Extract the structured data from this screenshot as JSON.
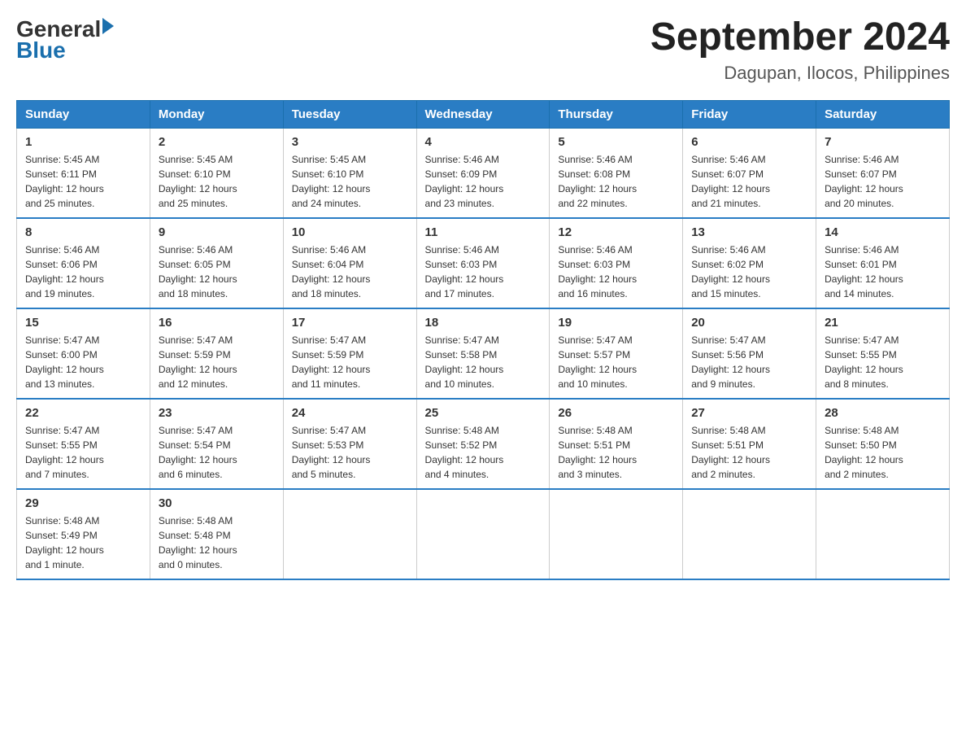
{
  "logo": {
    "general": "General",
    "triangle": "",
    "blue": "Blue"
  },
  "title": "September 2024",
  "subtitle": "Dagupan, Ilocos, Philippines",
  "days_of_week": [
    "Sunday",
    "Monday",
    "Tuesday",
    "Wednesday",
    "Thursday",
    "Friday",
    "Saturday"
  ],
  "weeks": [
    [
      {
        "day": "1",
        "sunrise": "5:45 AM",
        "sunset": "6:11 PM",
        "daylight": "12 hours and 25 minutes."
      },
      {
        "day": "2",
        "sunrise": "5:45 AM",
        "sunset": "6:10 PM",
        "daylight": "12 hours and 25 minutes."
      },
      {
        "day": "3",
        "sunrise": "5:45 AM",
        "sunset": "6:10 PM",
        "daylight": "12 hours and 24 minutes."
      },
      {
        "day": "4",
        "sunrise": "5:46 AM",
        "sunset": "6:09 PM",
        "daylight": "12 hours and 23 minutes."
      },
      {
        "day": "5",
        "sunrise": "5:46 AM",
        "sunset": "6:08 PM",
        "daylight": "12 hours and 22 minutes."
      },
      {
        "day": "6",
        "sunrise": "5:46 AM",
        "sunset": "6:07 PM",
        "daylight": "12 hours and 21 minutes."
      },
      {
        "day": "7",
        "sunrise": "5:46 AM",
        "sunset": "6:07 PM",
        "daylight": "12 hours and 20 minutes."
      }
    ],
    [
      {
        "day": "8",
        "sunrise": "5:46 AM",
        "sunset": "6:06 PM",
        "daylight": "12 hours and 19 minutes."
      },
      {
        "day": "9",
        "sunrise": "5:46 AM",
        "sunset": "6:05 PM",
        "daylight": "12 hours and 18 minutes."
      },
      {
        "day": "10",
        "sunrise": "5:46 AM",
        "sunset": "6:04 PM",
        "daylight": "12 hours and 18 minutes."
      },
      {
        "day": "11",
        "sunrise": "5:46 AM",
        "sunset": "6:03 PM",
        "daylight": "12 hours and 17 minutes."
      },
      {
        "day": "12",
        "sunrise": "5:46 AM",
        "sunset": "6:03 PM",
        "daylight": "12 hours and 16 minutes."
      },
      {
        "day": "13",
        "sunrise": "5:46 AM",
        "sunset": "6:02 PM",
        "daylight": "12 hours and 15 minutes."
      },
      {
        "day": "14",
        "sunrise": "5:46 AM",
        "sunset": "6:01 PM",
        "daylight": "12 hours and 14 minutes."
      }
    ],
    [
      {
        "day": "15",
        "sunrise": "5:47 AM",
        "sunset": "6:00 PM",
        "daylight": "12 hours and 13 minutes."
      },
      {
        "day": "16",
        "sunrise": "5:47 AM",
        "sunset": "5:59 PM",
        "daylight": "12 hours and 12 minutes."
      },
      {
        "day": "17",
        "sunrise": "5:47 AM",
        "sunset": "5:59 PM",
        "daylight": "12 hours and 11 minutes."
      },
      {
        "day": "18",
        "sunrise": "5:47 AM",
        "sunset": "5:58 PM",
        "daylight": "12 hours and 10 minutes."
      },
      {
        "day": "19",
        "sunrise": "5:47 AM",
        "sunset": "5:57 PM",
        "daylight": "12 hours and 10 minutes."
      },
      {
        "day": "20",
        "sunrise": "5:47 AM",
        "sunset": "5:56 PM",
        "daylight": "12 hours and 9 minutes."
      },
      {
        "day": "21",
        "sunrise": "5:47 AM",
        "sunset": "5:55 PM",
        "daylight": "12 hours and 8 minutes."
      }
    ],
    [
      {
        "day": "22",
        "sunrise": "5:47 AM",
        "sunset": "5:55 PM",
        "daylight": "12 hours and 7 minutes."
      },
      {
        "day": "23",
        "sunrise": "5:47 AM",
        "sunset": "5:54 PM",
        "daylight": "12 hours and 6 minutes."
      },
      {
        "day": "24",
        "sunrise": "5:47 AM",
        "sunset": "5:53 PM",
        "daylight": "12 hours and 5 minutes."
      },
      {
        "day": "25",
        "sunrise": "5:48 AM",
        "sunset": "5:52 PM",
        "daylight": "12 hours and 4 minutes."
      },
      {
        "day": "26",
        "sunrise": "5:48 AM",
        "sunset": "5:51 PM",
        "daylight": "12 hours and 3 minutes."
      },
      {
        "day": "27",
        "sunrise": "5:48 AM",
        "sunset": "5:51 PM",
        "daylight": "12 hours and 2 minutes."
      },
      {
        "day": "28",
        "sunrise": "5:48 AM",
        "sunset": "5:50 PM",
        "daylight": "12 hours and 2 minutes."
      }
    ],
    [
      {
        "day": "29",
        "sunrise": "5:48 AM",
        "sunset": "5:49 PM",
        "daylight": "12 hours and 1 minute."
      },
      {
        "day": "30",
        "sunrise": "5:48 AM",
        "sunset": "5:48 PM",
        "daylight": "12 hours and 0 minutes."
      },
      null,
      null,
      null,
      null,
      null
    ]
  ]
}
